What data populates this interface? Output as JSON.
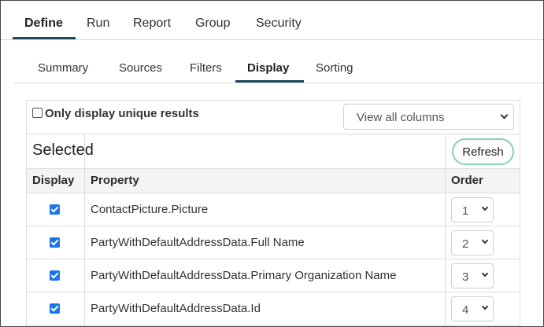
{
  "top_tabs": [
    {
      "label": "Define",
      "active": true
    },
    {
      "label": "Run",
      "active": false
    },
    {
      "label": "Report",
      "active": false
    },
    {
      "label": "Group",
      "active": false
    },
    {
      "label": "Security",
      "active": false
    }
  ],
  "sub_tabs": [
    {
      "label": "Summary",
      "active": false
    },
    {
      "label": "Sources",
      "active": false
    },
    {
      "label": "Filters",
      "active": false
    },
    {
      "label": "Display",
      "active": true
    },
    {
      "label": "Sorting",
      "active": false
    }
  ],
  "unique": {
    "label": "Only display unique results",
    "checked": false
  },
  "columns_select": {
    "value": "View all columns"
  },
  "selected_section": {
    "title": "Selected",
    "refresh_label": "Refresh"
  },
  "table": {
    "headers": {
      "display": "Display",
      "property": "Property",
      "order": "Order"
    },
    "rows": [
      {
        "checked": true,
        "property": "ContactPicture.Picture",
        "order": "1"
      },
      {
        "checked": true,
        "property": "PartyWithDefaultAddressData.Full Name",
        "order": "2"
      },
      {
        "checked": true,
        "property": "PartyWithDefaultAddressData.Primary Organization Name",
        "order": "3"
      },
      {
        "checked": true,
        "property": "PartyWithDefaultAddressData.Id",
        "order": "4"
      }
    ]
  },
  "colors": {
    "accent_underline": "#1c4a5c",
    "refresh_border": "#84d1b6",
    "checkbox": "#1a73e8"
  },
  "icons": {
    "dropdown": "chevron-down-icon",
    "checkbox_checked": "checkmark-icon"
  }
}
